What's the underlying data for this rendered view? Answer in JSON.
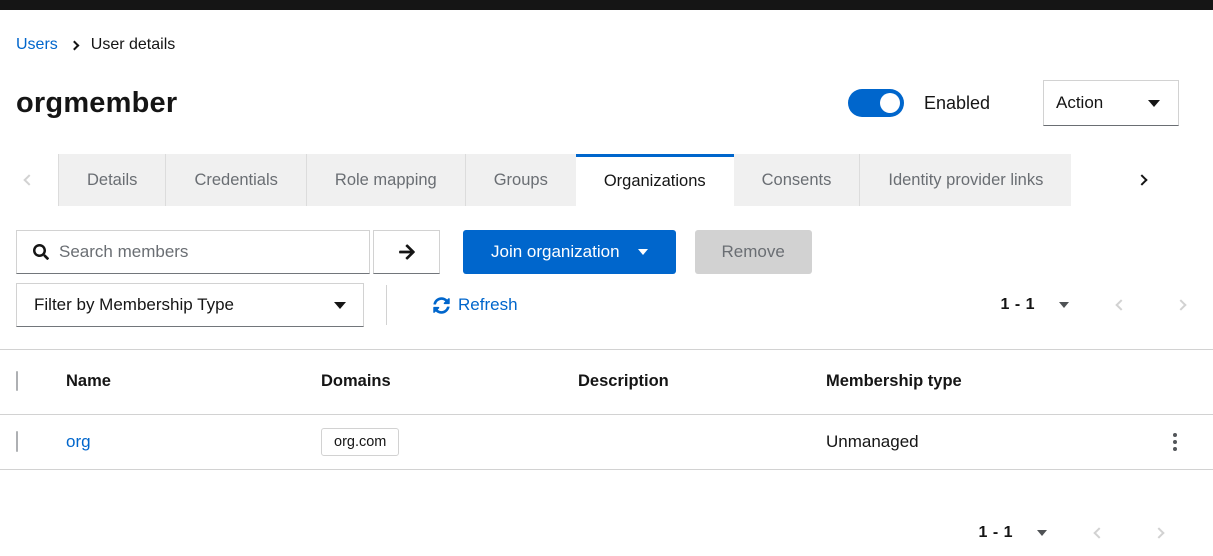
{
  "breadcrumb": {
    "users": "Users",
    "current": "User details"
  },
  "header": {
    "title": "orgmember",
    "toggle_state": "on",
    "toggle_label": "Enabled",
    "action_button": "Action"
  },
  "tabs": {
    "items": [
      "Details",
      "Credentials",
      "Role mapping",
      "Groups",
      "Organizations",
      "Consents",
      "Identity provider links"
    ],
    "active": "Organizations"
  },
  "toolbar": {
    "search": {
      "placeholder": "Search members",
      "value": ""
    },
    "join_button": "Join organization",
    "remove_button": "Remove",
    "filter_dropdown": "Filter by Membership Type",
    "refresh": "Refresh"
  },
  "pagination": {
    "top_range": "1 - 1",
    "bottom_range": "1 - 1"
  },
  "table": {
    "headers": [
      "Name",
      "Domains",
      "Description",
      "Membership type"
    ],
    "rows": [
      {
        "name": "org",
        "domains": [
          "org.com"
        ],
        "description": "",
        "membership_type": "Unmanaged"
      }
    ]
  },
  "icons": {
    "breadcrumb_divider": "angle-right",
    "search": "magnifying-glass",
    "search_submit": "arrow-right",
    "dropdown_caret": "caret-down",
    "refresh": "sync-arrows",
    "pagination_prev": "angle-left",
    "pagination_next": "angle-right",
    "tab_scroll_left": "angle-left",
    "tab_scroll_right": "angle-right",
    "row_actions": "kebab-dots"
  },
  "colors": {
    "accent_blue": "#0066cc",
    "masthead_black": "#151515",
    "text_dark": "#151515",
    "text_gray": "#6a6e73",
    "border_gray": "#d2d2d2",
    "disabled_bg": "#d2d2d2",
    "tab_bg": "#f0f0f0"
  }
}
